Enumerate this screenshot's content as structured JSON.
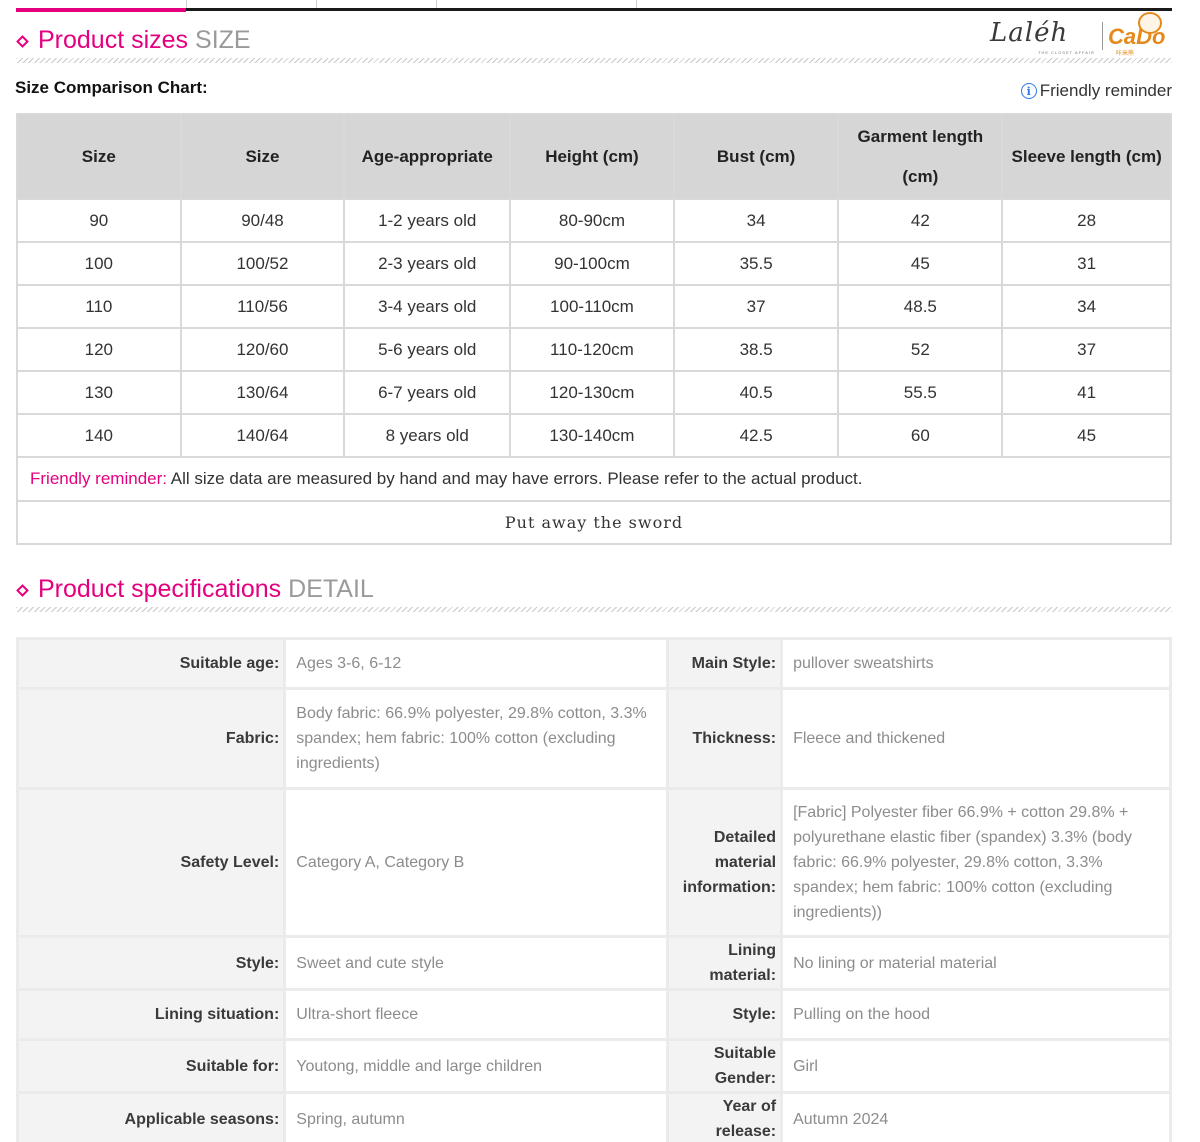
{
  "size_section": {
    "title_main": "Product sizes",
    "title_en": "SIZE",
    "chart_label": "Size Comparison Chart:",
    "reminder_link": "Friendly reminder"
  },
  "logo": {
    "script": "Laléh",
    "tagline": "THE CLOSET AFFAIR",
    "brand": "CaDo",
    "brand_sub": "咔米熊"
  },
  "size_table": {
    "headers": [
      "Size",
      "Size",
      "Age-appropriate",
      "Height (cm)",
      "Bust (cm)",
      "Garment length (cm)",
      "Sleeve length (cm)"
    ],
    "rows": [
      [
        "90",
        "90/48",
        "1-2 years old",
        "80-90cm",
        "34",
        "42",
        "28"
      ],
      [
        "100",
        "100/52",
        "2-3 years old",
        "90-100cm",
        "35.5",
        "45",
        "31"
      ],
      [
        "110",
        "110/56",
        "3-4 years old",
        "100-110cm",
        "37",
        "48.5",
        "34"
      ],
      [
        "120",
        "120/60",
        "5-6 years old",
        "110-120cm",
        "38.5",
        "52",
        "37"
      ],
      [
        "130",
        "130/64",
        "6-7 years old",
        "120-130cm",
        "40.5",
        "55.5",
        "41"
      ],
      [
        "140",
        "140/64",
        "8 years old",
        "130-140cm",
        "42.5",
        "60",
        "45"
      ]
    ],
    "note_label": "Friendly reminder:",
    "note_text": " All size data are measured by hand and may have errors. Please refer to the actual product.",
    "footer": "Put away the sword"
  },
  "spec_section": {
    "title_main": "Product specifications",
    "title_en": "DETAIL"
  },
  "spec_table": [
    {
      "k1": "Suitable age:",
      "v1": "Ages 3-6, 6-12",
      "k2": "Main Style:",
      "v2": "pullover sweatshirts"
    },
    {
      "k1": "Fabric:",
      "v1": "Body fabric: 66.9% polyester, 29.8% cotton, 3.3% spandex; hem fabric: 100% cotton (excluding ingredients)",
      "k2": "Thickness:",
      "v2": "Fleece and thickened"
    },
    {
      "k1": "Safety Level:",
      "v1": "Category A, Category B",
      "k2": "Detailed material information:",
      "v2": "[Fabric] Polyester fiber 66.9% + cotton 29.8% + polyurethane elastic fiber (spandex) 3.3% (body fabric: 66.9% polyester, 29.8% cotton, 3.3% spandex; hem fabric: 100% cotton (excluding ingredients))"
    },
    {
      "k1": "Style:",
      "v1": "Sweet and cute style",
      "k2": "Lining material:",
      "v2": "No lining or material material"
    },
    {
      "k1": "Lining situation:",
      "v1": "Ultra-short fleece",
      "k2": "Style:",
      "v2": "Pulling on the hood"
    },
    {
      "k1": "Suitable for:",
      "v1": "Youtong, middle and large children",
      "k2": "Suitable Gender:",
      "v2": "Girl"
    },
    {
      "k1": "Applicable seasons:",
      "v1": "Spring, autumn",
      "k2": "Year of release:",
      "v2": "Autumn 2024"
    }
  ]
}
